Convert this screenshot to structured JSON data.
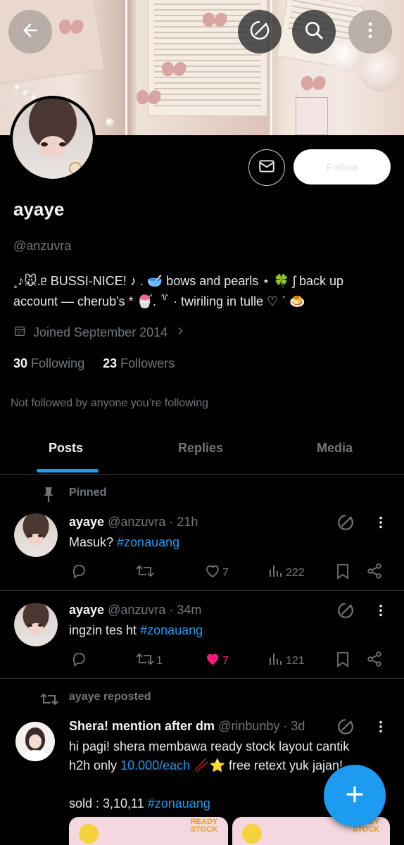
{
  "profile": {
    "name": "ayaye",
    "handle": "@anzuvra",
    "bio_line1": "˳♪🐭.ᥱ BUSSI-NICE! ♪ .  🥣 bows and pearls  ⋆ 🍀 ʃ back up",
    "bio_line2": "account — cherub's * 🍧. ꒷ · twiriling in tulle ♡ ˊ  🍮",
    "joined": "Joined September 2014",
    "following_count": "30",
    "following_label": "Following",
    "followers_count": "23",
    "followers_label": "Followers",
    "not_followed": "Not followed by anyone you’re following",
    "follow_button": "Follow"
  },
  "tabs": [
    "Posts",
    "Replies",
    "Media"
  ],
  "posts": [
    {
      "context": "Pinned",
      "name": "ayaye",
      "handle": "@anzuvra",
      "time": "· 21h",
      "text": "Masuk? ",
      "tag": "#zonauang",
      "replies": "",
      "reposts": "",
      "likes": "7",
      "views": "222",
      "liked": false
    },
    {
      "context": "",
      "name": "ayaye",
      "handle": "@anzuvra",
      "time": "· 34m",
      "text": "ingzin tes ht ",
      "tag": "#zonauang",
      "replies": "",
      "reposts": "1",
      "likes": "7",
      "views": "121",
      "liked": true
    },
    {
      "context": "ayaye reposted",
      "name": "Shera! mention after dm",
      "handle": "@rinbunby",
      "time": "· 3d",
      "text_line1": "hi pagi! shera membawa ready stock layout cantik",
      "text_line2_a": "h2h only ",
      "text_line2_link": "10.000/each",
      "text_line2_b": " 🥢⭐ free retext yuk jajan!",
      "text_line3": "sold : 3,10,11 ",
      "tag": "#zonauang",
      "media_label": "READY STOCK"
    }
  ],
  "colors": {
    "accent": "#1d9bf0",
    "like": "#f91880",
    "muted": "#71767b",
    "background": "#000000"
  },
  "icons": [
    "back-arrow-icon",
    "grok-icon",
    "search-icon",
    "more-vertical-icon",
    "mail-icon",
    "calendar-icon",
    "chevron-right-icon",
    "pin-icon",
    "reply-icon",
    "repost-icon",
    "like-icon",
    "views-icon",
    "bookmark-icon",
    "share-icon",
    "compose-plus-icon"
  ]
}
